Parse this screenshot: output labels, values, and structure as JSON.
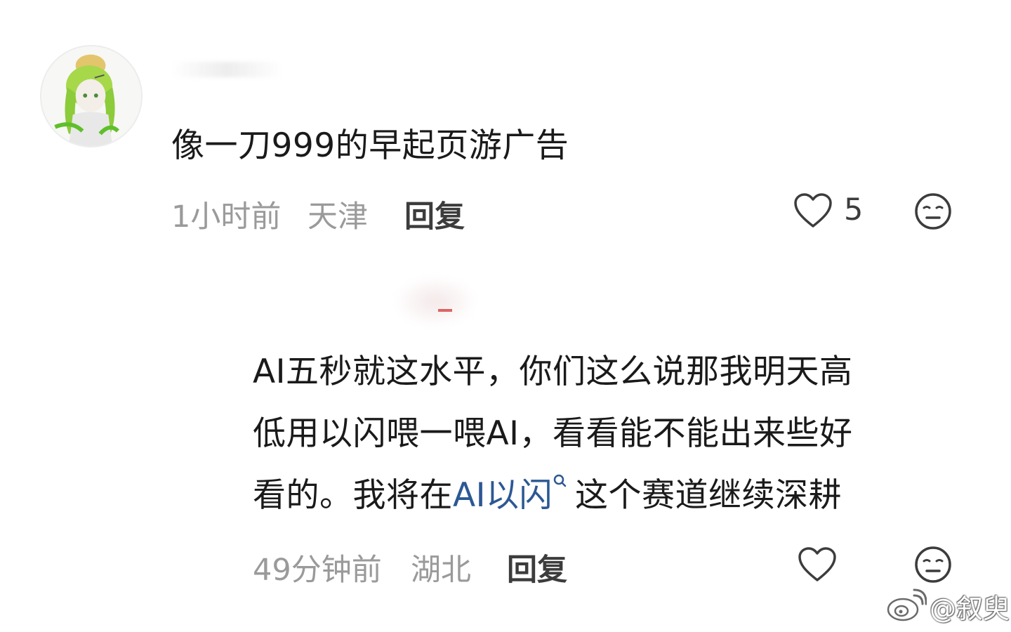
{
  "comment1": {
    "text": "像一刀999的早起页游广告",
    "time": "1小时前",
    "location": "天津",
    "reply_label": "回复",
    "like_count": "5"
  },
  "comment2": {
    "text_lines": [
      "AI五秒就这水平，你们这么说那我明天高",
      "低用以闪喂一喂AI，看看能不能出来些好"
    ],
    "line3_before": "看的。我将在",
    "line3_link": "AI以闪",
    "line3_after": "这个赛道继续深耕",
    "time": "49分钟前",
    "location": "湖北",
    "reply_label": "回复"
  },
  "watermark": {
    "text": "@叙臾"
  },
  "colors": {
    "text": "#1a1a1a",
    "meta": "#9a9a9a",
    "link": "#2c5894",
    "icon": "#3c3c3c"
  },
  "icons": {
    "like": "heart-icon",
    "dislike": "neutral-face-icon",
    "search": "search-icon",
    "watermark": "weibo-logo-icon"
  }
}
